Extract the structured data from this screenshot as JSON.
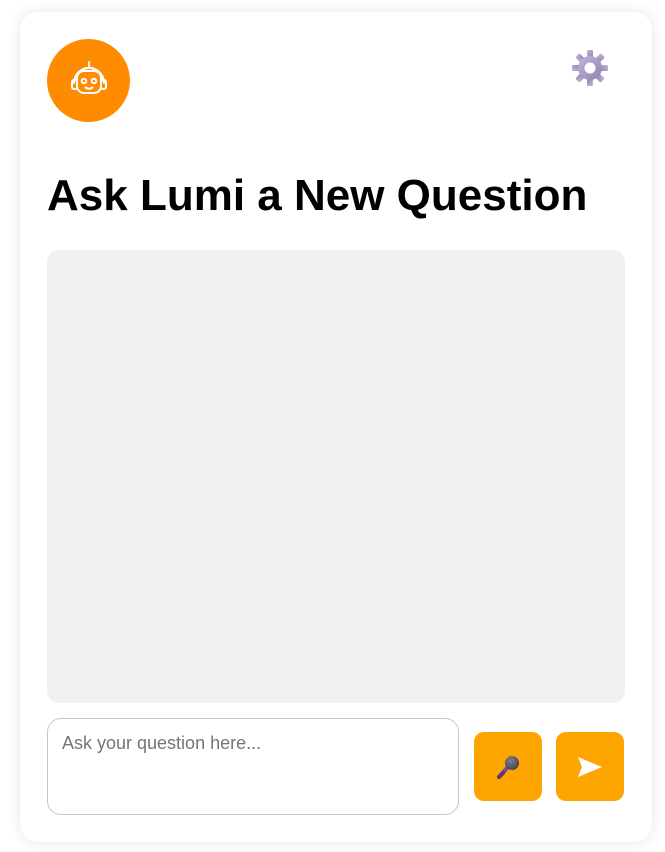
{
  "header": {
    "avatar_icon": "robot-icon",
    "avatar_color": "#ff8c00",
    "settings_icon": "gear-icon"
  },
  "main": {
    "title": "Ask Lumi a New Question"
  },
  "chat": {
    "background": "#f0f0f0"
  },
  "composer": {
    "input_value": "",
    "input_placeholder": "Ask your question here...",
    "mic_icon": "microphone-icon",
    "send_icon": "send-arrow-icon",
    "button_color": "#ffa500"
  }
}
